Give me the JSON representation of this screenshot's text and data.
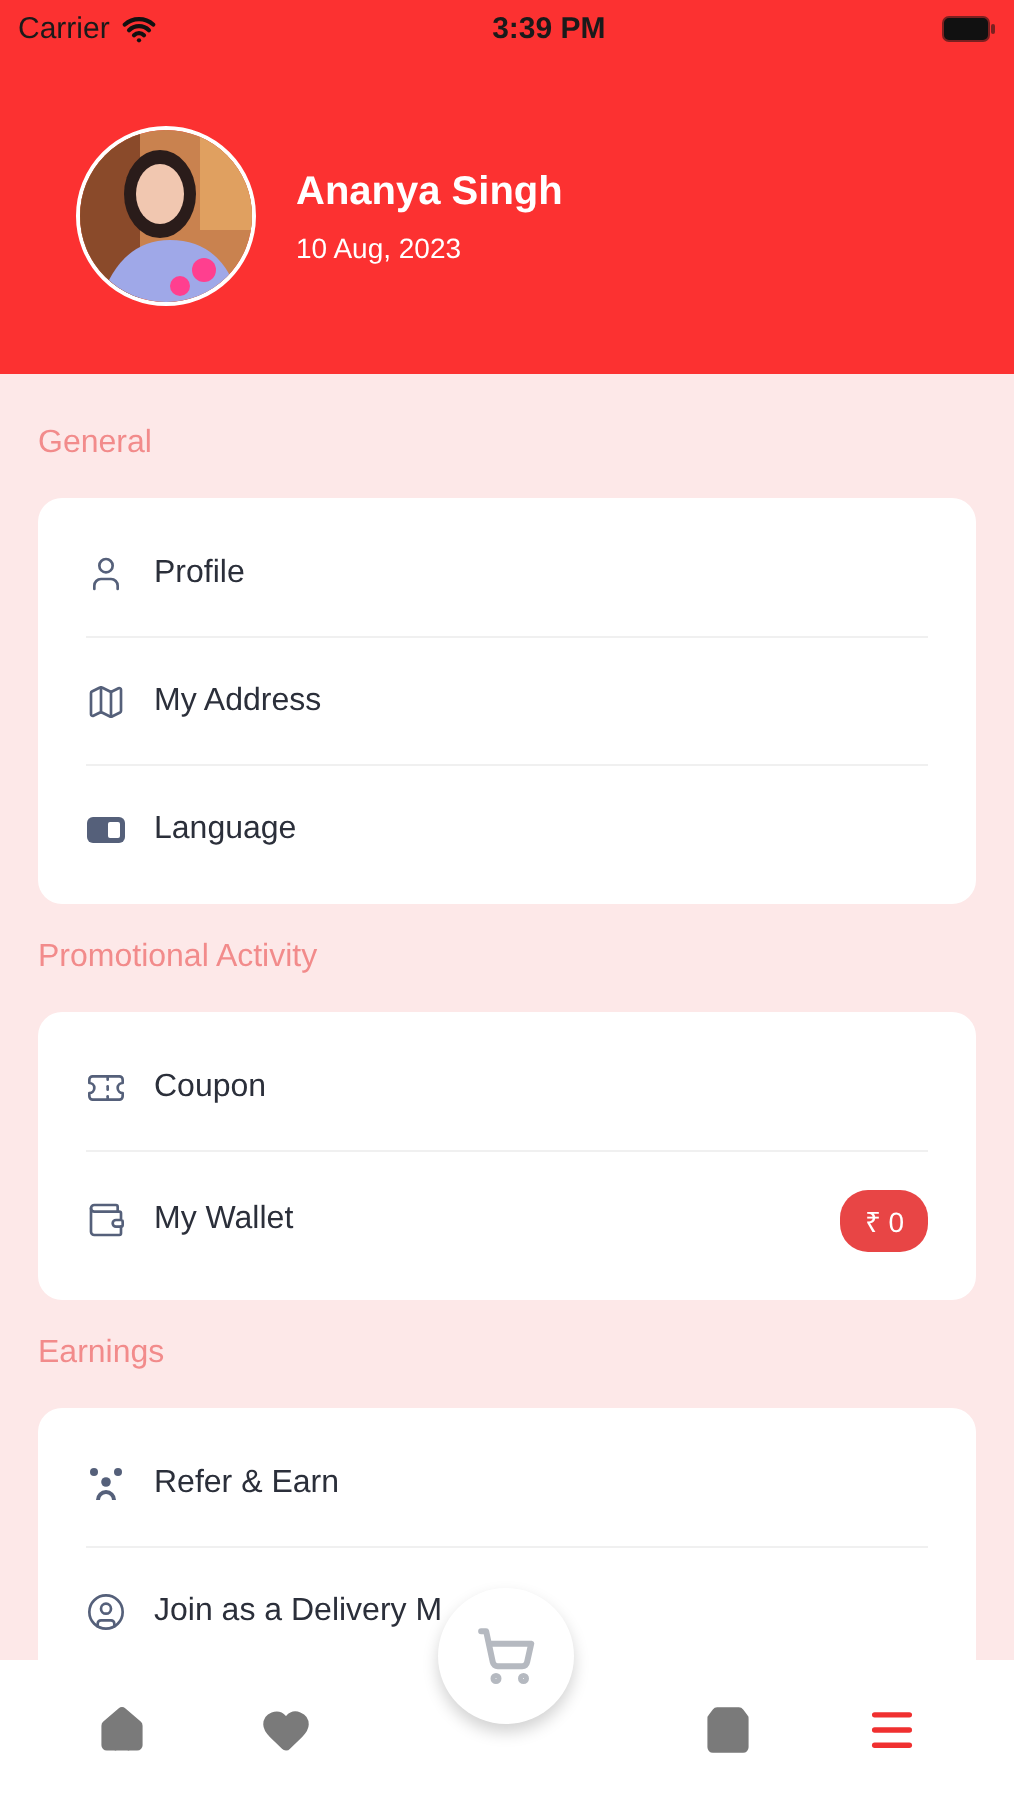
{
  "status_bar": {
    "carrier": "Carrier",
    "time": "3:39 PM"
  },
  "profile": {
    "name": "Ananya Singh",
    "date": "10 Aug, 2023"
  },
  "sections": [
    {
      "title": "General",
      "items": [
        {
          "kind": "profile",
          "label": "Profile"
        },
        {
          "kind": "address",
          "label": "My Address"
        },
        {
          "kind": "language",
          "label": "Language"
        }
      ]
    },
    {
      "title": "Promotional Activity",
      "items": [
        {
          "kind": "coupon",
          "label": "Coupon"
        },
        {
          "kind": "wallet",
          "label": "My Wallet",
          "badge": "₹ 0"
        }
      ]
    },
    {
      "title": "Earnings",
      "items": [
        {
          "kind": "refer",
          "label": "Refer & Earn"
        },
        {
          "kind": "delivery",
          "label": "Join as a Delivery M"
        }
      ]
    }
  ],
  "bottom_nav": [
    {
      "kind": "home",
      "selected": false
    },
    {
      "kind": "favorites",
      "selected": false
    },
    {
      "kind": "cart",
      "selected": false
    },
    {
      "kind": "bag",
      "selected": false
    },
    {
      "kind": "menu",
      "selected": true
    }
  ]
}
